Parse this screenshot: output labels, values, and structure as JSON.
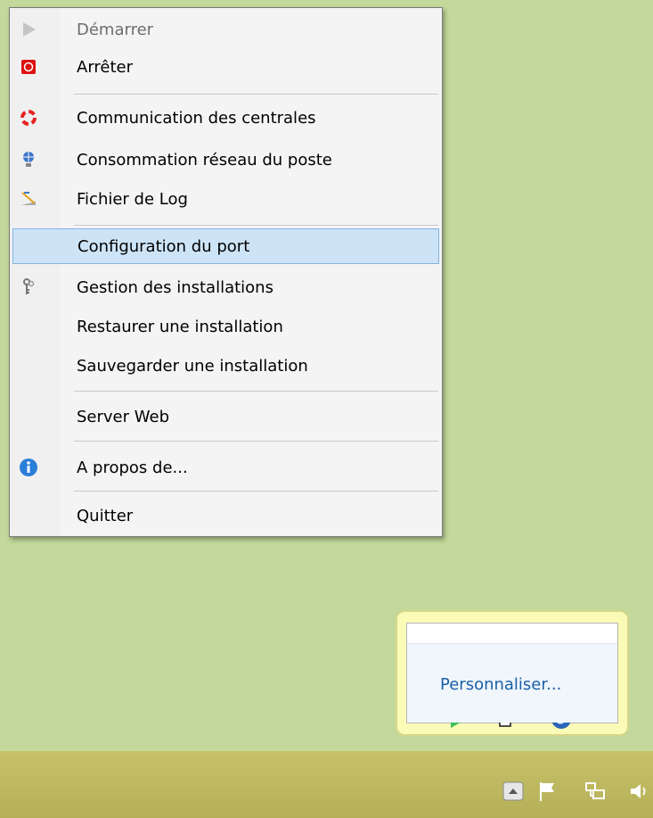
{
  "context_menu": {
    "items": [
      {
        "label": "Démarrer",
        "icon": "play-icon",
        "disabled": true
      },
      {
        "label": "Arrêter",
        "icon": "stop-icon"
      },
      {
        "label": "Communication des centrales",
        "icon": "lifebuoy-icon"
      },
      {
        "label": "Consommation réseau du poste",
        "icon": "network-globe-icon"
      },
      {
        "label": "Fichier de Log",
        "icon": "log-file-icon"
      },
      {
        "label": "Configuration du port",
        "icon": null,
        "selected": true
      },
      {
        "label": "Gestion des installations",
        "icon": "keys-icon"
      },
      {
        "label": "Restaurer une installation",
        "icon": null
      },
      {
        "label": "Sauvegarder une installation",
        "icon": null
      },
      {
        "label": "Server Web",
        "icon": null
      },
      {
        "label": "A propos de...",
        "icon": "info-icon"
      },
      {
        "label": "Quitter",
        "icon": null
      }
    ],
    "colors": {
      "selected_bg": "#cde4f7",
      "selected_border": "#84b3e0"
    }
  },
  "tray_popup": {
    "icons": [
      "monitor-icon",
      "media-icon",
      "printer-check-icon",
      "play-icon",
      "window-icon",
      "globe-icon",
      "avira-icon",
      "mail-download-icon"
    ],
    "customize_link": "Personnaliser..."
  },
  "taskbar": {
    "icons": [
      "show-hidden-icons-arrow",
      "action-center-flag-icon",
      "network-icon",
      "volume-icon"
    ]
  }
}
